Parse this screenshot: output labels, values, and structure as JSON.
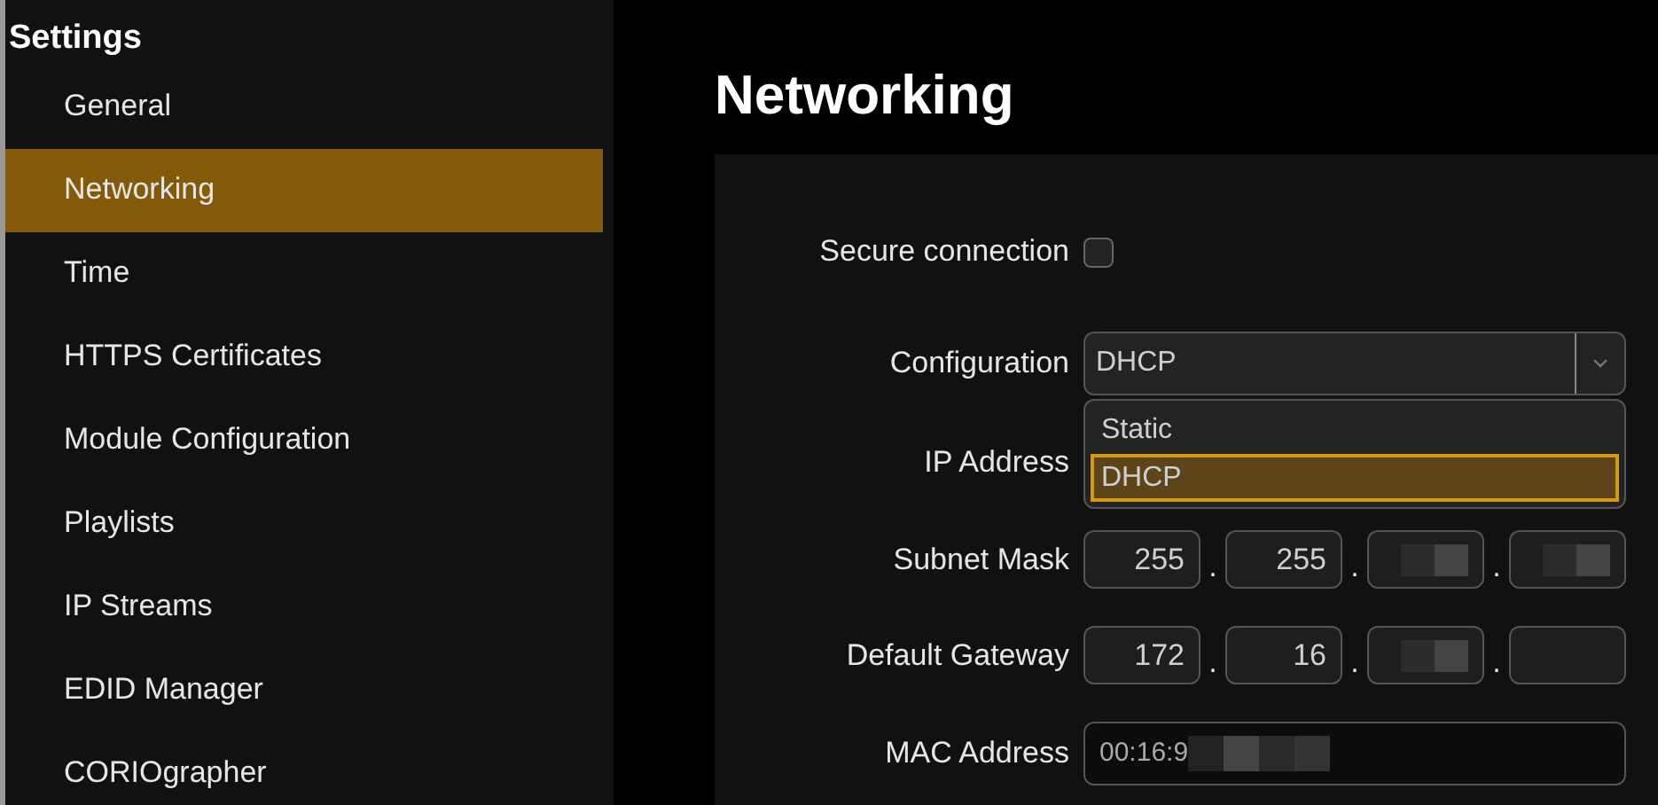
{
  "sidebar": {
    "title": "Settings",
    "items": [
      {
        "label": "General",
        "selected": false
      },
      {
        "label": "Networking",
        "selected": true
      },
      {
        "label": "Time",
        "selected": false
      },
      {
        "label": "HTTPS Certificates",
        "selected": false
      },
      {
        "label": "Module Configuration",
        "selected": false
      },
      {
        "label": "Playlists",
        "selected": false
      },
      {
        "label": "IP Streams",
        "selected": false
      },
      {
        "label": "EDID Manager",
        "selected": false
      },
      {
        "label": "CORIOgrapher",
        "selected": false
      }
    ]
  },
  "page": {
    "title": "Networking",
    "secure_connection": {
      "label": "Secure connection",
      "checked": false
    },
    "configuration": {
      "label": "Configuration",
      "value": "DHCP",
      "expanded": true,
      "options": [
        {
          "label": "Static",
          "selected": false
        },
        {
          "label": "DHCP",
          "selected": true
        }
      ]
    },
    "ip_address": {
      "label": "IP Address"
    },
    "subnet_mask": {
      "label": "Subnet Mask",
      "separator": ".",
      "octets": [
        {
          "value": "255",
          "redacted": false
        },
        {
          "value": "255",
          "redacted": false
        },
        {
          "redacted": true
        },
        {
          "redacted": true
        }
      ]
    },
    "default_gateway": {
      "label": "Default Gateway",
      "separator": ".",
      "octets": [
        {
          "value": "172",
          "redacted": false
        },
        {
          "value": "16",
          "redacted": false
        },
        {
          "redacted": true
        },
        {
          "redacted": false
        }
      ]
    },
    "mac_address": {
      "label": "MAC Address",
      "value": "00:16:9",
      "redacted": true
    }
  }
}
